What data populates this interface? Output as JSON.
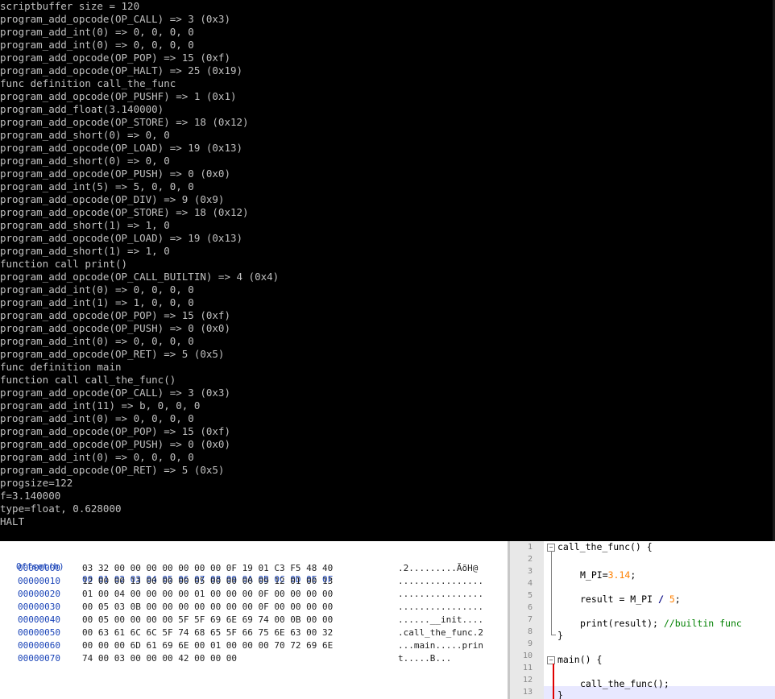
{
  "console": {
    "lines": [
      "scriptbuffer size = 120",
      "program_add_opcode(OP_CALL) => 3 (0x3)",
      "program_add_int(0) => 0, 0, 0, 0",
      "program_add_int(0) => 0, 0, 0, 0",
      "program_add_opcode(OP_POP) => 15 (0xf)",
      "program_add_opcode(OP_HALT) => 25 (0x19)",
      "func definition call_the_func",
      "program_add_opcode(OP_PUSHF) => 1 (0x1)",
      "program_add_float(3.140000)",
      "program_add_opcode(OP_STORE) => 18 (0x12)",
      "program_add_short(0) => 0, 0",
      "program_add_opcode(OP_LOAD) => 19 (0x13)",
      "program_add_short(0) => 0, 0",
      "program_add_opcode(OP_PUSH) => 0 (0x0)",
      "program_add_int(5) => 5, 0, 0, 0",
      "program_add_opcode(OP_DIV) => 9 (0x9)",
      "program_add_opcode(OP_STORE) => 18 (0x12)",
      "program_add_short(1) => 1, 0",
      "program_add_opcode(OP_LOAD) => 19 (0x13)",
      "program_add_short(1) => 1, 0",
      "function call print()",
      "program_add_opcode(OP_CALL_BUILTIN) => 4 (0x4)",
      "program_add_int(0) => 0, 0, 0, 0",
      "program_add_int(1) => 1, 0, 0, 0",
      "program_add_opcode(OP_POP) => 15 (0xf)",
      "program_add_opcode(OP_PUSH) => 0 (0x0)",
      "program_add_int(0) => 0, 0, 0, 0",
      "program_add_opcode(OP_RET) => 5 (0x5)",
      "func definition main",
      "function call call_the_func()",
      "program_add_opcode(OP_CALL) => 3 (0x3)",
      "program_add_int(11) => b, 0, 0, 0",
      "program_add_int(0) => 0, 0, 0, 0",
      "program_add_opcode(OP_POP) => 15 (0xf)",
      "program_add_opcode(OP_PUSH) => 0 (0x0)",
      "program_add_int(0) => 0, 0, 0, 0",
      "program_add_opcode(OP_RET) => 5 (0x5)",
      "progsize=122",
      "f=3.140000",
      "type=float, 0.628000",
      "HALT"
    ]
  },
  "hex": {
    "offset_header": "Offset(h)",
    "columns_header": "00 01 02 03 04 05 06 07 08 09 0A 0B 0C 0D 0E 0F",
    "rows": [
      {
        "offset": "00000000",
        "bytes": "03 32 00 00 00 00 00 00 00 0F 19 01 C3 F5 48 40",
        "ascii": ".2.........ÃõH@"
      },
      {
        "offset": "00000010",
        "bytes": "12 00 00 13 00 00 00 05 00 00 00 09 12 01 00 13",
        "ascii": "................"
      },
      {
        "offset": "00000020",
        "bytes": "01 00 04 00 00 00 00 01 00 00 00 0F 00 00 00 00",
        "ascii": "................"
      },
      {
        "offset": "00000030",
        "bytes": "00 05 03 0B 00 00 00 00 00 00 00 0F 00 00 00 00",
        "ascii": "................"
      },
      {
        "offset": "00000040",
        "bytes": "00 05 00 00 00 00 5F 5F 69 6E 69 74 00 0B 00 00",
        "ascii": "......__init...."
      },
      {
        "offset": "00000050",
        "bytes": "00 63 61 6C 6C 5F 74 68 65 5F 66 75 6E 63 00 32",
        "ascii": ".call_the_func.2"
      },
      {
        "offset": "00000060",
        "bytes": "00 00 00 6D 61 69 6E 00 01 00 00 00 70 72 69 6E",
        "ascii": "...main.....prin"
      },
      {
        "offset": "00000070",
        "bytes": "74 00 03 00 00 00 42 00 00 00",
        "ascii": "t.....B..."
      }
    ]
  },
  "editor": {
    "line_numbers": [
      "1",
      "2",
      "3",
      "4",
      "5",
      "6",
      "7",
      "8",
      "9",
      "10",
      "11",
      "12",
      "13"
    ],
    "code": {
      "l1": "call_the_func() {",
      "l3_var": "M_PI=",
      "l3_num": "3.14",
      "l3_end": ";",
      "l5_a": "result = M_PI ",
      "l5_op": "/",
      "l5_b": " ",
      "l5_num": "5",
      "l5_end": ";",
      "l7_a": "print(result); ",
      "l7_com": "//builtin func",
      "l8": "}",
      "l10": "main() {",
      "l12": "call_the_func();",
      "l13": "}"
    }
  }
}
